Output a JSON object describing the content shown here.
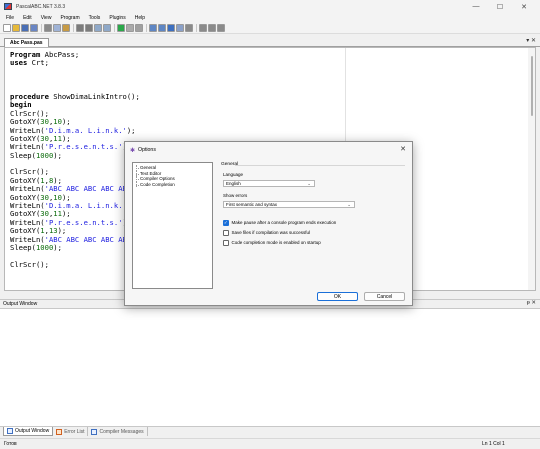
{
  "window": {
    "title": "PascalABC.NET 3.8.3",
    "minimize": "—",
    "maximize": "☐",
    "close": "✕"
  },
  "menu": [
    "File",
    "Edit",
    "View",
    "Program",
    "Tools",
    "Plugins",
    "Help"
  ],
  "toolbar": {
    "buttons": [
      {
        "icon": "new-file-icon",
        "color": "#ffffff"
      },
      {
        "icon": "open-folder-icon",
        "color": "#e6b93a"
      },
      {
        "icon": "save-icon",
        "color": "#4a6fb5"
      },
      {
        "icon": "save-all-icon",
        "color": "#6a86c4"
      },
      {
        "sep": true
      },
      {
        "icon": "cut-icon",
        "color": "#8a8a8a"
      },
      {
        "icon": "copy-icon",
        "color": "#9fb3d6"
      },
      {
        "icon": "paste-icon",
        "color": "#c79b45"
      },
      {
        "sep": true
      },
      {
        "icon": "undo-icon",
        "color": "#7c7c7c"
      },
      {
        "icon": "redo-icon",
        "color": "#7c7c7c"
      },
      {
        "icon": "find-icon",
        "color": "#8fa9c9"
      },
      {
        "icon": "replace-icon",
        "color": "#8fa9c9"
      },
      {
        "sep": true
      },
      {
        "icon": "run-icon",
        "color": "#2aa84a"
      },
      {
        "icon": "stop-icon",
        "color": "#aaaaaa"
      },
      {
        "icon": "compile-icon",
        "color": "#a0a0a0"
      },
      {
        "sep": true
      },
      {
        "icon": "step-over-icon",
        "color": "#5e86c4"
      },
      {
        "icon": "step-into-icon",
        "color": "#5e86c4"
      },
      {
        "icon": "breakpoint-icon",
        "color": "#3d6fc0"
      },
      {
        "icon": "watch-icon",
        "color": "#8aa0c8"
      },
      {
        "icon": "format-icon",
        "color": "#8a8a8a"
      },
      {
        "sep": true
      },
      {
        "icon": "comment-icon",
        "color": "#8a8a8a"
      },
      {
        "icon": "uncomment-icon",
        "color": "#8a8a8a"
      },
      {
        "icon": "bookmark-icon",
        "color": "#8a8a8a"
      }
    ]
  },
  "tabs": {
    "active_label": "Abc Pass.pas",
    "pin": "▾",
    "close": "✕"
  },
  "editor": {
    "lines": [
      [
        {
          "t": "Program",
          "c": "kw"
        },
        {
          "t": " AbcPass;"
        }
      ],
      [
        {
          "t": "uses",
          "c": "kw"
        },
        {
          "t": " Crt;"
        }
      ],
      [],
      [],
      [],
      [
        {
          "t": "procedure",
          "c": "kw"
        },
        {
          "t": " ShowDimaLinkIntro();"
        }
      ],
      [
        {
          "t": "begin",
          "c": "kw"
        }
      ],
      [
        {
          "t": "ClrScr();"
        }
      ],
      [
        {
          "t": "GotoXY("
        },
        {
          "t": "30",
          "c": "num"
        },
        {
          "t": ","
        },
        {
          "t": "10",
          "c": "num"
        },
        {
          "t": ");"
        }
      ],
      [
        {
          "t": "WriteLn("
        },
        {
          "t": "'D.i.m.a. L.i.n.k.'",
          "c": "str"
        },
        {
          "t": ");"
        }
      ],
      [
        {
          "t": "GotoXY("
        },
        {
          "t": "30",
          "c": "num"
        },
        {
          "t": ","
        },
        {
          "t": "11",
          "c": "num"
        },
        {
          "t": ");"
        }
      ],
      [
        {
          "t": "WriteLn("
        },
        {
          "t": "'P.r.e.s.e.n.t.s.'",
          "c": "str"
        },
        {
          "t": ");"
        }
      ],
      [
        {
          "t": "Sleep("
        },
        {
          "t": "1000",
          "c": "num"
        },
        {
          "t": ");"
        }
      ],
      [],
      [
        {
          "t": "ClrScr();"
        }
      ],
      [
        {
          "t": "GotoXY("
        },
        {
          "t": "1",
          "c": "num"
        },
        {
          "t": ","
        },
        {
          "t": "8",
          "c": "num"
        },
        {
          "t": ");"
        }
      ],
      [
        {
          "t": "WriteLn("
        },
        {
          "t": "'ABC ABC ABC ABC ABC",
          "c": "str"
        }
      ],
      [
        {
          "t": "GotoXY("
        },
        {
          "t": "30",
          "c": "num"
        },
        {
          "t": ","
        },
        {
          "t": "10",
          "c": "num"
        },
        {
          "t": ");"
        }
      ],
      [
        {
          "t": "WriteLn("
        },
        {
          "t": "'D.i.m.a. L.i.n.k.'",
          "c": "str"
        },
        {
          "t": ")"
        }
      ],
      [
        {
          "t": "GotoXY("
        },
        {
          "t": "30",
          "c": "num"
        },
        {
          "t": ","
        },
        {
          "t": "11",
          "c": "num"
        },
        {
          "t": ");"
        }
      ],
      [
        {
          "t": "WriteLn("
        },
        {
          "t": "'P.r.e.s.e.n.t.s.'",
          "c": "str"
        },
        {
          "t": ");"
        }
      ],
      [
        {
          "t": "GotoXY("
        },
        {
          "t": "1",
          "c": "num"
        },
        {
          "t": ","
        },
        {
          "t": "13",
          "c": "num"
        },
        {
          "t": ");"
        }
      ],
      [
        {
          "t": "WriteLn("
        },
        {
          "t": "'ABC ABC ABC ABC ABC",
          "c": "str"
        }
      ],
      [
        {
          "t": "Sleep("
        },
        {
          "t": "1000",
          "c": "num"
        },
        {
          "t": ");"
        }
      ],
      [],
      [
        {
          "t": "ClrScr();"
        }
      ]
    ]
  },
  "output": {
    "title": "Output Window",
    "pin": "ᵽ",
    "close": "✕"
  },
  "bottom_tabs": [
    {
      "label": "Output Window",
      "icon": "output-window-icon",
      "active": true
    },
    {
      "label": "Error List",
      "icon": "error-list-icon",
      "active": false
    },
    {
      "label": "Compiler Messages",
      "icon": "compiler-messages-icon",
      "active": false
    }
  ],
  "status": {
    "left": "Готов",
    "position": "Ln 1 Col 1"
  },
  "dialog": {
    "title": "Options",
    "icon": "✱",
    "close": "✕",
    "tree": [
      "General",
      "Text Editor",
      "Compiler Options",
      "Code Completion"
    ],
    "section_title": "General",
    "language_label": "Language",
    "language_value": "English",
    "show_errors_label": "Show errors",
    "show_errors_value": "First semantic and syntax",
    "chevron": "⌄",
    "checkboxes": [
      {
        "label": "Make pause after a console program ends execution",
        "checked": true
      },
      {
        "label": "Save files if compilation was successful",
        "checked": false
      },
      {
        "label": "Code completion mode is enabled on startup",
        "checked": false
      }
    ],
    "check_mark": "✓",
    "ok": "OK",
    "cancel": "Cancel"
  }
}
